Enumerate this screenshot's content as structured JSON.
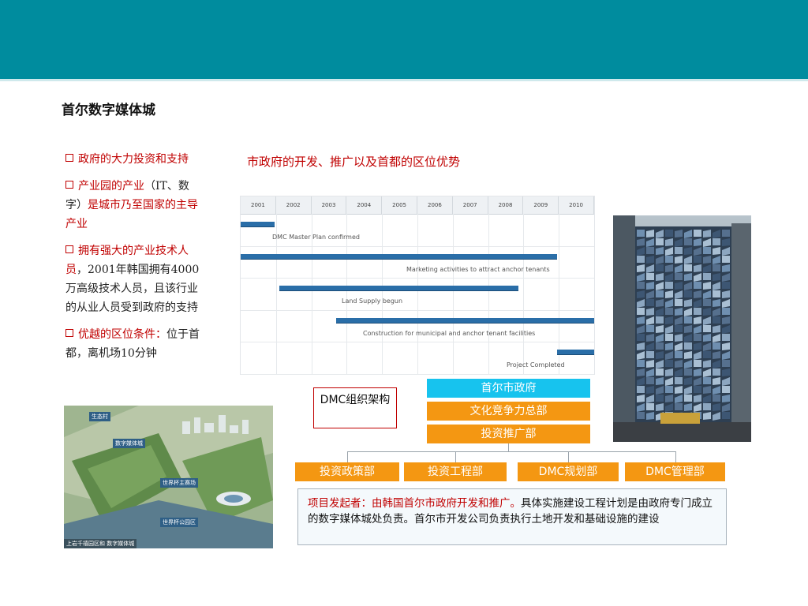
{
  "slide": {
    "title": "首尔数字媒体城",
    "subtitle": "市政府的开发、推广以及首都的区位优势"
  },
  "bullets": [
    {
      "red": "政府的大力投资和支持",
      "black": ""
    },
    {
      "red": "产业园的产业",
      "black": "（IT、数字）",
      "red2": "是城市乃至国家的主导产业"
    },
    {
      "red": "拥有强大的产业技术人员",
      "black": "，2001年韩国拥有4000万高级技术人员，且该行业的从业人员受到政府的支持"
    },
    {
      "red": "优越的区位条件：",
      "black": "位于首都，离机场10分钟"
    }
  ],
  "gantt": {
    "years": [
      "2001",
      "2002",
      "2003",
      "2004",
      "2005",
      "2006",
      "2007",
      "2008",
      "2009",
      "2010"
    ],
    "tasks": [
      {
        "label": "DMC Master Plan confirmed",
        "start": 0,
        "end": 0.95
      },
      {
        "label": "Marketing activities to attract anchor tenants",
        "start": 0,
        "end": 8.95
      },
      {
        "label": "Land Supply begun",
        "start": 1.1,
        "end": 7.85
      },
      {
        "label": "Construction for municipal and anchor tenant facilities",
        "start": 2.7,
        "end": 10
      },
      {
        "label": "Project Completed",
        "start": 8.95,
        "end": 10
      }
    ]
  },
  "map": {
    "tags": [
      "生态村",
      "数字媒体城",
      "世界杯主赛场",
      "世界杯公园区"
    ],
    "caption": "上岩千禧园区和 数字媒体城"
  },
  "org": {
    "label": "DMC组织架构",
    "top": "首尔市政府",
    "level2": "文化竞争力总部",
    "level3": "投资推广部",
    "departments": [
      "投资政策部",
      "投资工程部",
      "DMC规划部",
      "DMC管理部"
    ]
  },
  "note": {
    "red": "项目发起者：由韩国首尔市政府开发和推广。",
    "black": "具体实施建设工程计划是由政府专门成立的数字媒体城处负责。首尔市开发公司负责执行土地开发和基础设施的建设"
  },
  "colors": {
    "header": "#008c9e",
    "accent_red": "#c00000",
    "org_top": "#17c3ee",
    "org_orange": "#f49712",
    "gantt_bar": "#2a6ea8"
  }
}
